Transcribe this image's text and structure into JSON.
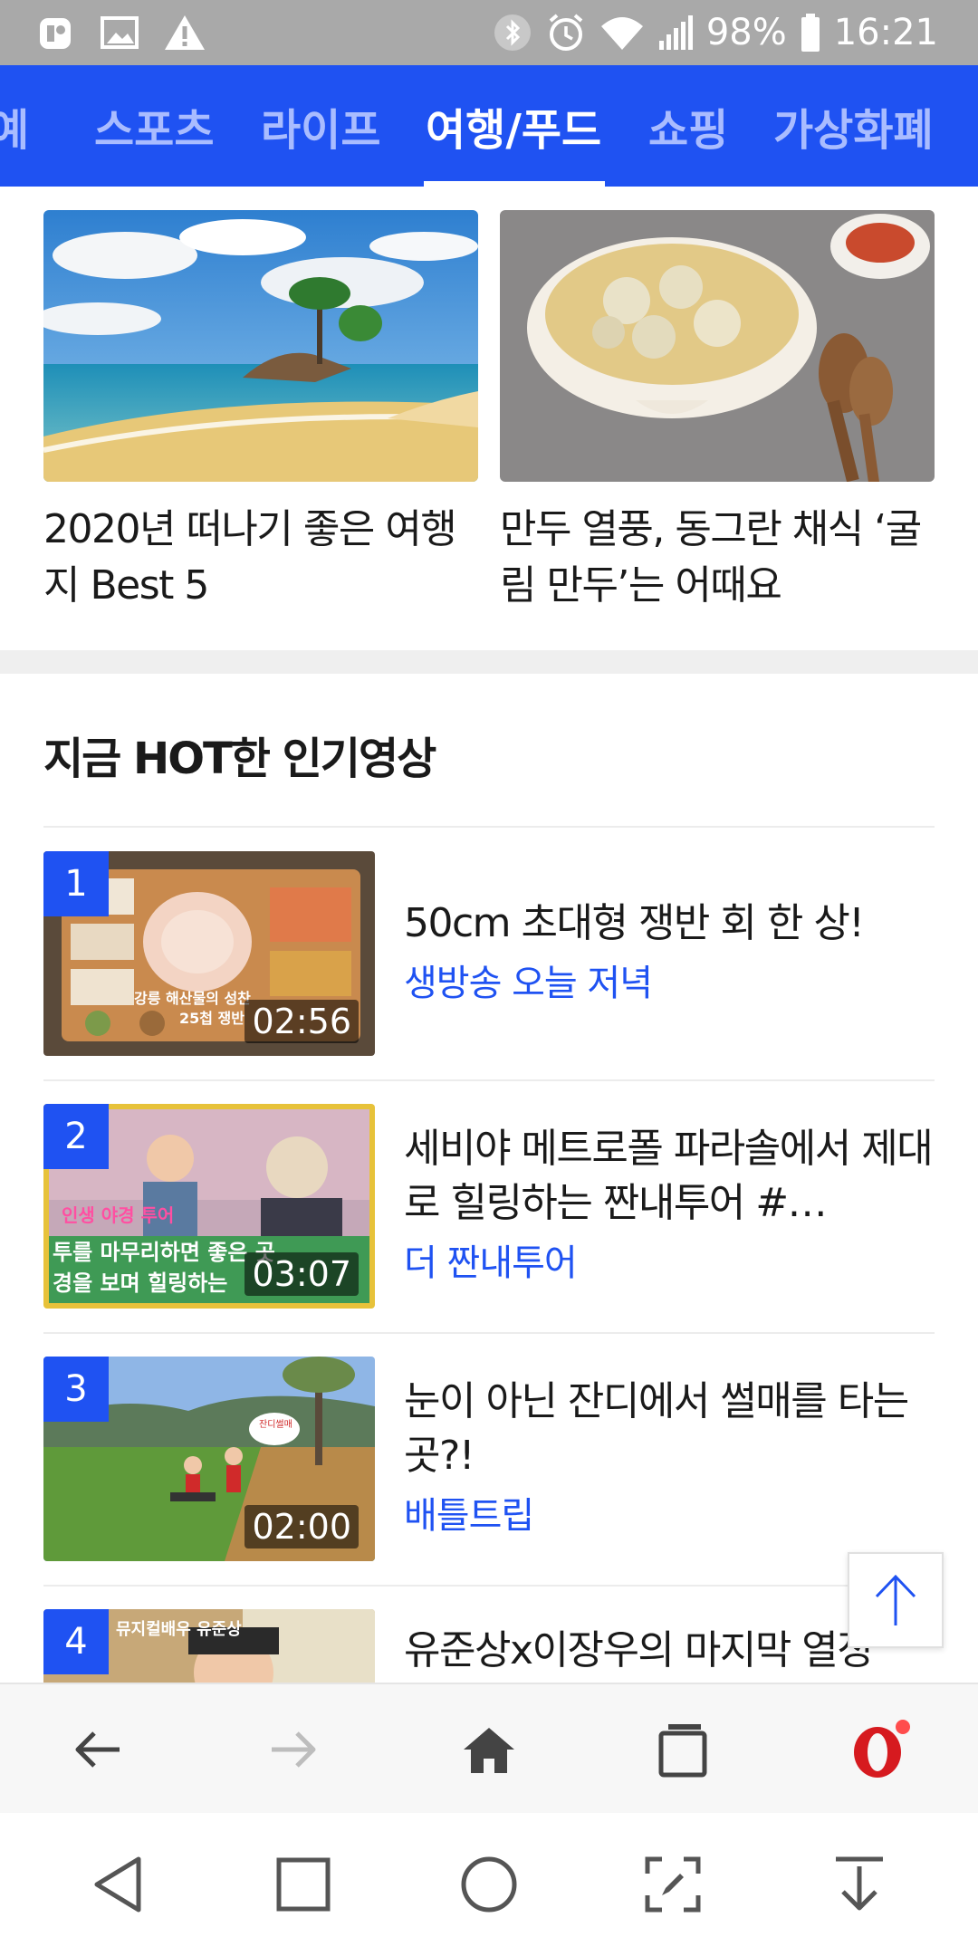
{
  "status_bar": {
    "battery": "98%",
    "time": "16:21",
    "left_icons": [
      "notification-app-icon",
      "image-icon",
      "warning-icon"
    ],
    "right_icons": [
      "bluetooth-icon",
      "alarm-icon",
      "wifi-icon",
      "signal-icon",
      "battery-icon"
    ]
  },
  "tabs": {
    "items": [
      {
        "label": "예"
      },
      {
        "label": "스포츠"
      },
      {
        "label": "라이프"
      },
      {
        "label": "여행/푸드"
      },
      {
        "label": "쇼핑"
      },
      {
        "label": "가상화폐"
      }
    ],
    "active": "여행/푸드",
    "accent_color": "#1f52f2"
  },
  "articles": [
    {
      "title": "2020년 떠나기 좋은 여행지 Best 5",
      "image": "tropical-beach-photo"
    },
    {
      "title": "만두 열풍, 동그란 채식 ‘굴림 만두’는 어때요",
      "image": "dumpling-soup-photo"
    }
  ],
  "videos_section": {
    "title": "지금 HOT한 인기영상",
    "items": [
      {
        "rank": "1",
        "duration": "02:56",
        "title": "50cm 초대형 쟁반 회 한 상!",
        "channel": "생방송 오늘 저녁"
      },
      {
        "rank": "2",
        "duration": "03:07",
        "title": "세비야 메트로폴 파라솔에서 제대로 힐링하는 짠내투어 #…",
        "channel": "더 짠내투어"
      },
      {
        "rank": "3",
        "duration": "02:00",
        "title": "눈이 아닌 잔디에서 썰매를 타는 곳?!",
        "channel": "배틀트립"
      },
      {
        "rank": "4",
        "duration": "",
        "title": "유준상x이장우의 마지막 열정",
        "channel": ""
      }
    ]
  },
  "browser_toolbar": {
    "buttons": [
      "back-arrow-icon",
      "forward-arrow-icon",
      "home-icon",
      "tabs-icon",
      "opera-menu-icon"
    ]
  },
  "android_nav": {
    "buttons": [
      "back-triangle-icon",
      "recents-square-icon",
      "home-circle-icon",
      "screenshot-edit-icon",
      "download-icon"
    ]
  }
}
